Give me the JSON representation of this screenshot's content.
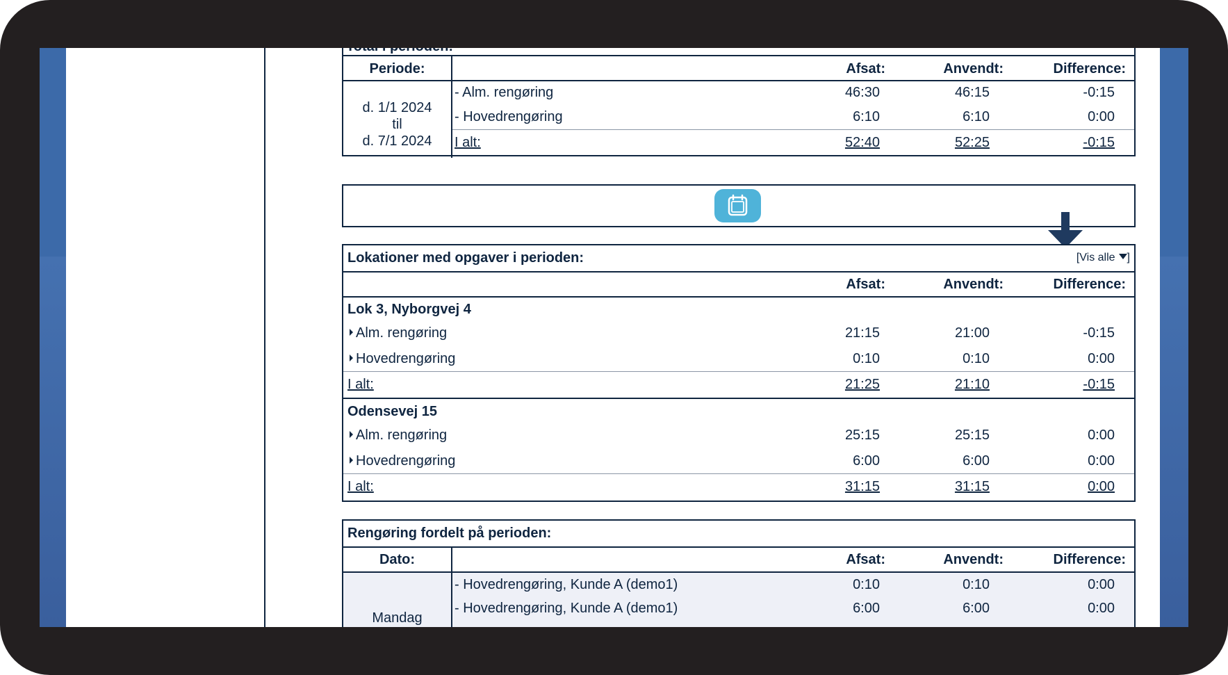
{
  "total": {
    "title": "Total i perioden:",
    "col_periode": "Periode:",
    "col_afsat": "Afsat:",
    "col_anvendt": "Anvendt:",
    "col_difference": "Difference:",
    "period_from": "d. 1/1 2024",
    "period_til": "til",
    "period_to": "d. 7/1 2024",
    "rows": [
      {
        "label": "- Alm. rengøring",
        "afsat": "46:30",
        "anvendt": "46:15",
        "diff": "-0:15"
      },
      {
        "label": "- Hovedrengøring",
        "afsat": "6:10",
        "anvendt": "6:10",
        "diff": "0:00"
      }
    ],
    "total_label": "I alt:",
    "total_afsat": "52:40",
    "total_anvendt": "52:25",
    "total_diff": "-0:15"
  },
  "calendar_button": {
    "icon": "calendar-icon"
  },
  "lokationer": {
    "title": "Lokationer med opgaver i perioden:",
    "vis_alle": "[Vis alle",
    "vis_alle_end": "]",
    "col_afsat": "Afsat:",
    "col_anvendt": "Anvendt:",
    "col_difference": "Difference:",
    "locations": [
      {
        "name": "Lok 3, Nyborgvej 4",
        "rows": [
          {
            "label": "Alm. rengøring",
            "afsat": "21:15",
            "anvendt": "21:00",
            "diff": "-0:15"
          },
          {
            "label": "Hovedrengøring",
            "afsat": "0:10",
            "anvendt": "0:10",
            "diff": "0:00"
          }
        ],
        "total_label": "I alt:",
        "total_afsat": "21:25",
        "total_anvendt": "21:10",
        "total_diff": "-0:15"
      },
      {
        "name": "Odensevej 15",
        "rows": [
          {
            "label": "Alm. rengøring",
            "afsat": "25:15",
            "anvendt": "25:15",
            "diff": "0:00"
          },
          {
            "label": "Hovedrengøring",
            "afsat": "6:00",
            "anvendt": "6:00",
            "diff": "0:00"
          }
        ],
        "total_label": "I alt:",
        "total_afsat": "31:15",
        "total_anvendt": "31:15",
        "total_diff": "0:00"
      }
    ]
  },
  "fordelt": {
    "title": "Rengøring fordelt på perioden:",
    "col_dato": "Dato:",
    "col_afsat": "Afsat:",
    "col_anvendt": "Anvendt:",
    "col_difference": "Difference:",
    "day": "Mandag",
    "rows": [
      {
        "label": "-  Hovedrengøring, Kunde A (demo1)",
        "afsat": "0:10",
        "anvendt": "0:10",
        "diff": "0:00"
      },
      {
        "label": "-  Hovedrengøring, Kunde A (demo1)",
        "afsat": "6:00",
        "anvendt": "6:00",
        "diff": "0:00"
      }
    ]
  },
  "colors": {
    "accent": "#4fb3d9",
    "border": "#0f2540",
    "row_bg": "#eef0f7"
  }
}
